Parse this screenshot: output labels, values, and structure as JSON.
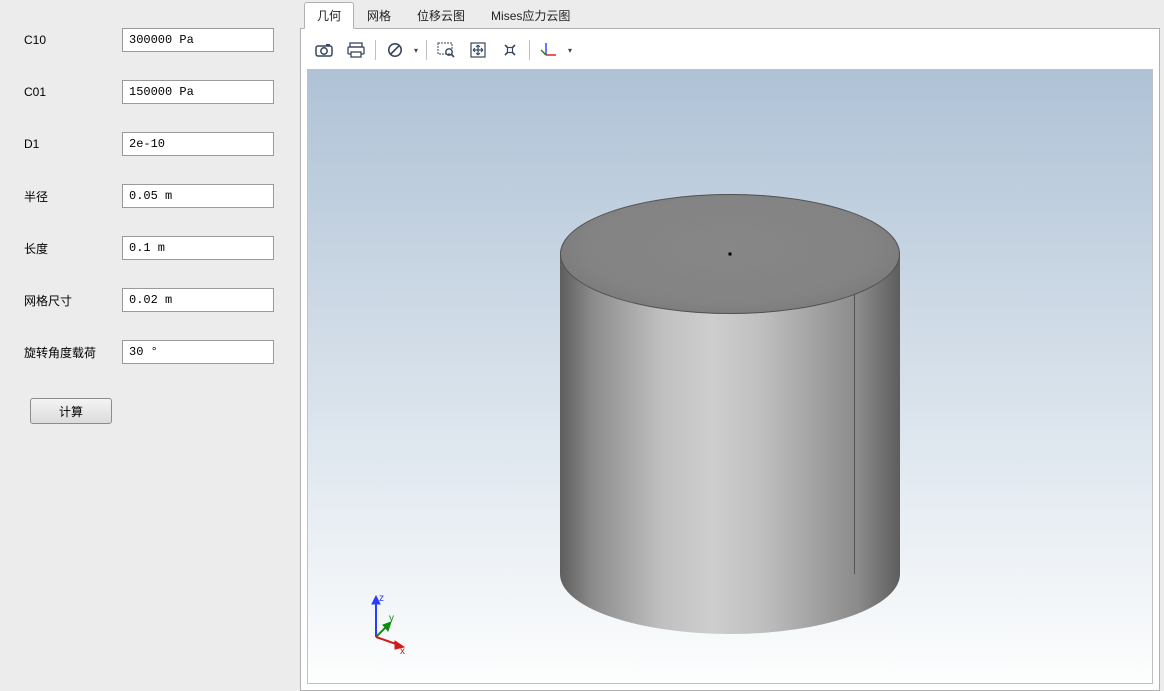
{
  "sidebar": {
    "fields": [
      {
        "label": "C10",
        "value": "300000 Pa"
      },
      {
        "label": "C01",
        "value": "150000 Pa"
      },
      {
        "label": "D1",
        "value": "2e-10"
      },
      {
        "label": "半径",
        "value": "0.05 m"
      },
      {
        "label": "长度",
        "value": "0.1 m"
      },
      {
        "label": "网格尺寸",
        "value": "0.02 m"
      },
      {
        "label": "旋转角度载荷",
        "value": "30 °"
      }
    ],
    "calc_button": "计算"
  },
  "tabs": [
    {
      "label": "几何",
      "active": true
    },
    {
      "label": "网格",
      "active": false
    },
    {
      "label": "位移云图",
      "active": false
    },
    {
      "label": "Mises应力云图",
      "active": false
    }
  ],
  "toolbar_icons": {
    "camera": "camera-icon",
    "print": "print-icon",
    "nosymbol": "cancel-icon",
    "zoom_select": "zoom-select-icon",
    "fit": "fit-view-icon",
    "cross": "reset-view-icon",
    "axes": "axes-icon"
  },
  "axis_gizmo": {
    "z": "z",
    "y": "y",
    "x": "x"
  }
}
